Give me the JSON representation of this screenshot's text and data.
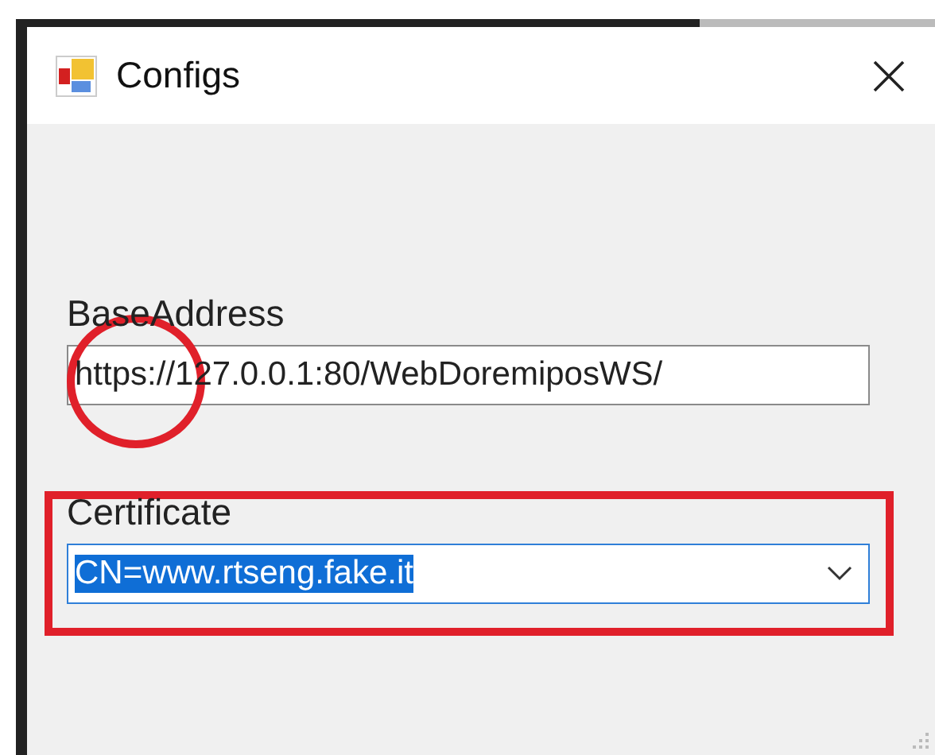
{
  "window": {
    "title": "Configs"
  },
  "fields": [
    {
      "kind": "text",
      "label": "BaseAddress",
      "value": "https://127.0.0.1:80/WebDoremiposWS/",
      "focused": false,
      "text_selected": false
    },
    {
      "kind": "combo",
      "label": "Certificate",
      "value": "CN=www.rtseng.fake.it",
      "focused": true,
      "text_selected": true
    }
  ],
  "annotations": [
    {
      "kind": "circle",
      "color": "#e0202a"
    },
    {
      "kind": "rectangle",
      "color": "#e0202a"
    }
  ]
}
